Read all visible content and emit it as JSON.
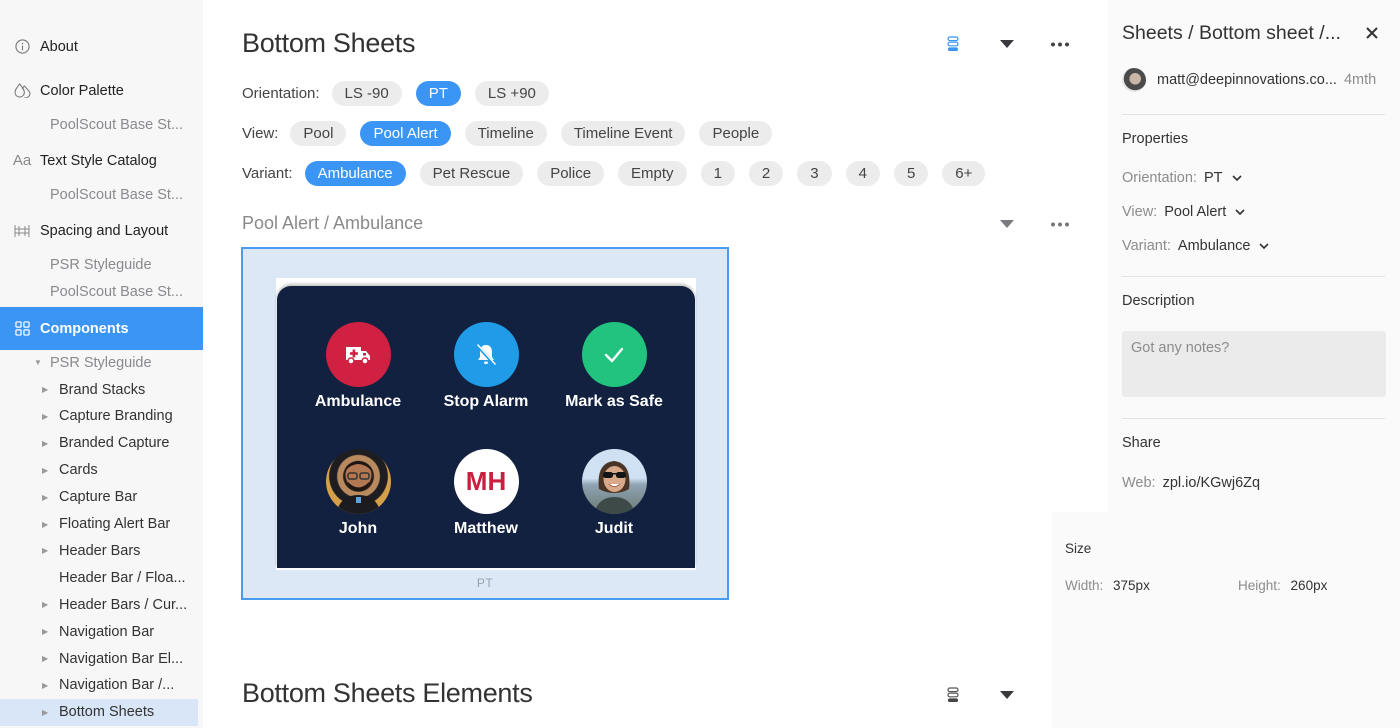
{
  "sidebar": {
    "about": "About",
    "color_palette": "Color Palette",
    "color_palette_sub": "PoolScout Base St...",
    "text_style_catalog": "Text Style Catalog",
    "text_style_sub": "PoolScout Base St...",
    "spacing_layout": "Spacing and Layout",
    "spacing_sub_1": "PSR Styleguide",
    "spacing_sub_2": "PoolScout Base St...",
    "components": "Components",
    "tree_root": "PSR Styleguide",
    "tree_items": [
      {
        "label": "Brand Stacks",
        "expandable": true
      },
      {
        "label": "Capture Branding",
        "expandable": true
      },
      {
        "label": "Branded Capture",
        "expandable": true
      },
      {
        "label": "Cards",
        "expandable": true
      },
      {
        "label": "Capture Bar",
        "expandable": true
      },
      {
        "label": "Floating Alert Bar",
        "expandable": true
      },
      {
        "label": "Header Bars",
        "expandable": true
      },
      {
        "label": "Header Bar / Floa...",
        "expandable": false
      },
      {
        "label": "Header Bars / Cur...",
        "expandable": true
      },
      {
        "label": "Navigation Bar",
        "expandable": true
      },
      {
        "label": "Navigation Bar El...",
        "expandable": true
      },
      {
        "label": "Navigation Bar /...",
        "expandable": true
      },
      {
        "label": "Bottom Sheets",
        "expandable": true,
        "selected": true
      }
    ]
  },
  "main": {
    "title": "Bottom Sheets",
    "filters": {
      "orientation": {
        "label": "Orientation:",
        "options": [
          "LS -90",
          "PT",
          "LS +90"
        ],
        "selected": "PT"
      },
      "view": {
        "label": "View:",
        "options": [
          "Pool",
          "Pool Alert",
          "Timeline",
          "Timeline Event",
          "People"
        ],
        "selected": "Pool Alert"
      },
      "variant": {
        "label": "Variant:",
        "options": [
          "Ambulance",
          "Pet Rescue",
          "Police",
          "Empty",
          "1",
          "2",
          "3",
          "4",
          "5",
          "6+"
        ],
        "selected": "Ambulance"
      }
    },
    "component_title": "Pool Alert / Ambulance",
    "artboard": {
      "caption": "PT",
      "actions": [
        {
          "label": "Ambulance",
          "icon": "ambulance-icon",
          "color": "#d02142"
        },
        {
          "label": "Stop Alarm",
          "icon": "bell-off-icon",
          "color": "#1f9be8"
        },
        {
          "label": "Mark as Safe",
          "icon": "check-icon",
          "color": "#22c37f"
        }
      ],
      "people": [
        {
          "label": "John",
          "type": "photo"
        },
        {
          "label": "Matthew",
          "type": "initials",
          "initials": "MH",
          "initials_color": "#c8203e"
        },
        {
          "label": "Judit",
          "type": "photo"
        }
      ]
    },
    "section2_title": "Bottom Sheets Elements"
  },
  "right_panel": {
    "title": "Sheets / Bottom sheet /...",
    "user_email": "matt@deepinnovations.co...",
    "age": "4mth",
    "properties_heading": "Properties",
    "properties": [
      {
        "key": "Orientation:",
        "value": "PT"
      },
      {
        "key": "View:",
        "value": "Pool Alert"
      },
      {
        "key": "Variant:",
        "value": "Ambulance"
      }
    ],
    "description_heading": "Description",
    "description_placeholder": "Got any notes?",
    "share_heading": "Share",
    "web_key": "Web:",
    "web_value": "zpl.io/KGwj6Zq",
    "size_heading": "Size",
    "width_key": "Width:",
    "width_value": "375px",
    "height_key": "Height:",
    "height_value": "260px"
  },
  "colors": {
    "accent": "#3b95f5",
    "sheet_bg": "#12213f",
    "artboard_bg": "#dde8f7"
  }
}
